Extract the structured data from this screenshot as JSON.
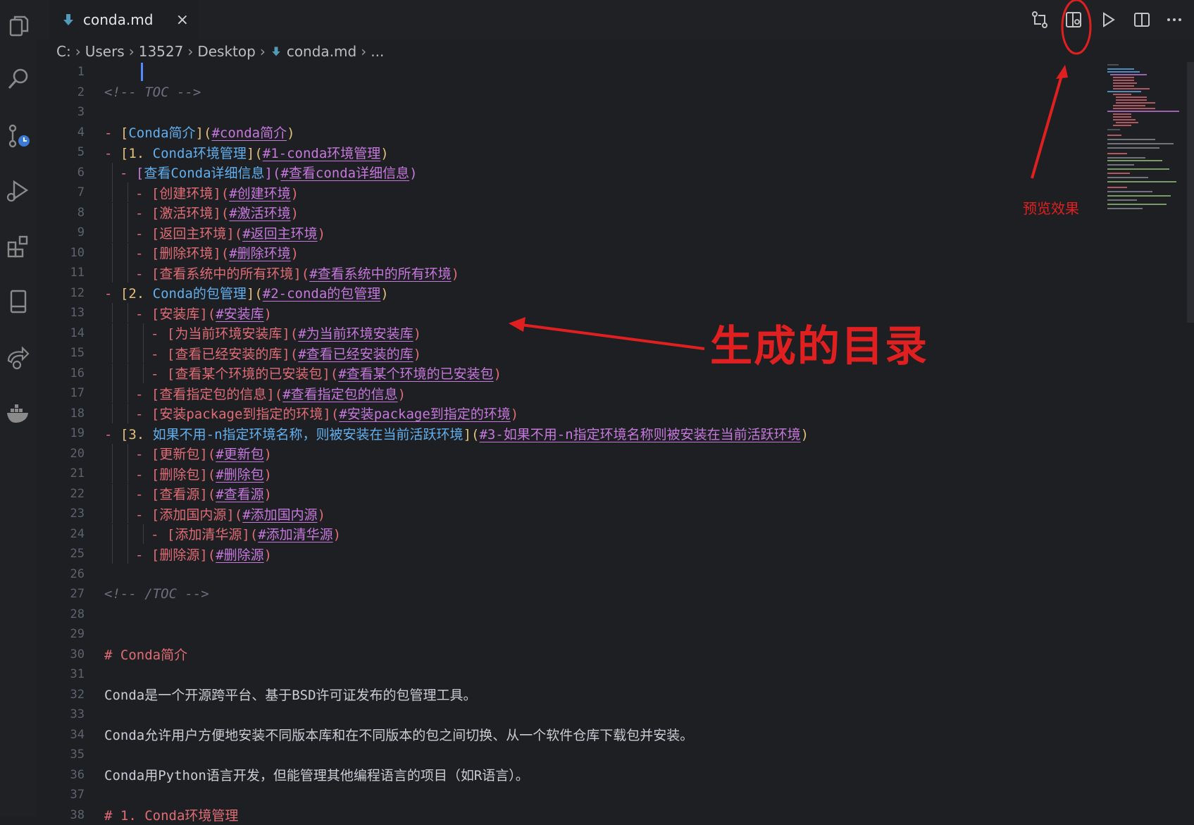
{
  "tab": {
    "label": "conda.md",
    "close": "×"
  },
  "breadcrumb": [
    "C:",
    "Users",
    "13527",
    "Desktop",
    "conda.md",
    "..."
  ],
  "annotations": {
    "preview": "预览效果",
    "toc": "生成的目录"
  },
  "colors": {
    "annotation": "#e02020",
    "link": "#c678dd",
    "heading": "#e06c75"
  },
  "lines": [
    {
      "n": "1",
      "g": 0,
      "s": []
    },
    {
      "n": "2",
      "g": 0,
      "s": [
        {
          "c": "c-comment",
          "t": "<!-- TOC -->"
        }
      ]
    },
    {
      "n": "3",
      "g": 0,
      "s": []
    },
    {
      "n": "4",
      "g": 0,
      "s": [
        {
          "c": "c-dash",
          "t": "- "
        },
        {
          "c": "c-b1",
          "t": "["
        },
        {
          "c": "c-t1",
          "t": "Conda简介"
        },
        {
          "c": "c-b1",
          "t": "]("
        },
        {
          "c": "c-link",
          "t": "#conda简介"
        },
        {
          "c": "c-b1",
          "t": ")"
        }
      ]
    },
    {
      "n": "5",
      "g": 0,
      "s": [
        {
          "c": "c-dash",
          "t": "- "
        },
        {
          "c": "c-b1",
          "t": "["
        },
        {
          "c": "c-num",
          "t": "1. "
        },
        {
          "c": "c-t1",
          "t": "Conda环境管理"
        },
        {
          "c": "c-b1",
          "t": "]("
        },
        {
          "c": "c-link",
          "t": "#1-conda环境管理"
        },
        {
          "c": "c-b1",
          "t": ")"
        }
      ]
    },
    {
      "n": "6",
      "g": 1,
      "s": [
        {
          "c": "c-dash",
          "t": "- "
        },
        {
          "c": "c-b2",
          "t": "["
        },
        {
          "c": "c-t1",
          "t": "查看Conda详细信息"
        },
        {
          "c": "c-b2",
          "t": "]("
        },
        {
          "c": "c-link",
          "t": "#查看conda详细信息"
        },
        {
          "c": "c-b2",
          "t": ")"
        }
      ]
    },
    {
      "n": "7",
      "g": 2,
      "s": [
        {
          "c": "c-dash",
          "t": "- "
        },
        {
          "c": "c-t2",
          "t": "[创建环境]("
        },
        {
          "c": "c-link",
          "t": "#创建环境"
        },
        {
          "c": "c-t2",
          "t": ")"
        }
      ]
    },
    {
      "n": "8",
      "g": 2,
      "s": [
        {
          "c": "c-dash",
          "t": "- "
        },
        {
          "c": "c-t2",
          "t": "[激活环境]("
        },
        {
          "c": "c-link",
          "t": "#激活环境"
        },
        {
          "c": "c-t2",
          "t": ")"
        }
      ]
    },
    {
      "n": "9",
      "g": 2,
      "s": [
        {
          "c": "c-dash",
          "t": "- "
        },
        {
          "c": "c-t2",
          "t": "[返回主环境]("
        },
        {
          "c": "c-link",
          "t": "#返回主环境"
        },
        {
          "c": "c-t2",
          "t": ")"
        }
      ]
    },
    {
      "n": "10",
      "g": 2,
      "s": [
        {
          "c": "c-dash",
          "t": "- "
        },
        {
          "c": "c-t2",
          "t": "[删除环境]("
        },
        {
          "c": "c-link",
          "t": "#删除环境"
        },
        {
          "c": "c-t2",
          "t": ")"
        }
      ]
    },
    {
      "n": "11",
      "g": 2,
      "s": [
        {
          "c": "c-dash",
          "t": "- "
        },
        {
          "c": "c-t2",
          "t": "[查看系统中的所有环境]("
        },
        {
          "c": "c-link",
          "t": "#查看系统中的所有环境"
        },
        {
          "c": "c-t2",
          "t": ")"
        }
      ]
    },
    {
      "n": "12",
      "g": 0,
      "s": [
        {
          "c": "c-dash",
          "t": "- "
        },
        {
          "c": "c-b1",
          "t": "["
        },
        {
          "c": "c-num",
          "t": "2. "
        },
        {
          "c": "c-t1",
          "t": "Conda的包管理"
        },
        {
          "c": "c-b1",
          "t": "]("
        },
        {
          "c": "c-link",
          "t": "#2-conda的包管理"
        },
        {
          "c": "c-b1",
          "t": ")"
        }
      ]
    },
    {
      "n": "13",
      "g": 2,
      "s": [
        {
          "c": "c-dash",
          "t": "- "
        },
        {
          "c": "c-t2",
          "t": "[安装库]("
        },
        {
          "c": "c-link",
          "t": "#安装库"
        },
        {
          "c": "c-t2",
          "t": ")"
        }
      ]
    },
    {
      "n": "14",
      "g": 3,
      "s": [
        {
          "c": "c-dash",
          "t": "- "
        },
        {
          "c": "c-t2",
          "t": "[为当前环境安装库]("
        },
        {
          "c": "c-link",
          "t": "#为当前环境安装库"
        },
        {
          "c": "c-t2",
          "t": ")"
        }
      ]
    },
    {
      "n": "15",
      "g": 3,
      "s": [
        {
          "c": "c-dash",
          "t": "- "
        },
        {
          "c": "c-t2",
          "t": "[查看已经安装的库]("
        },
        {
          "c": "c-link",
          "t": "#查看已经安装的库"
        },
        {
          "c": "c-t2",
          "t": ")"
        }
      ]
    },
    {
      "n": "16",
      "g": 3,
      "s": [
        {
          "c": "c-dash",
          "t": "- "
        },
        {
          "c": "c-t2",
          "t": "[查看某个环境的已安装包]("
        },
        {
          "c": "c-link",
          "t": "#查看某个环境的已安装包"
        },
        {
          "c": "c-t2",
          "t": ")"
        }
      ]
    },
    {
      "n": "17",
      "g": 2,
      "s": [
        {
          "c": "c-dash",
          "t": "- "
        },
        {
          "c": "c-t2",
          "t": "[查看指定包的信息]("
        },
        {
          "c": "c-link",
          "t": "#查看指定包的信息"
        },
        {
          "c": "c-t2",
          "t": ")"
        }
      ]
    },
    {
      "n": "18",
      "g": 2,
      "s": [
        {
          "c": "c-dash",
          "t": "- "
        },
        {
          "c": "c-t2",
          "t": "[安装package到指定的环境]("
        },
        {
          "c": "c-link",
          "t": "#安装package到指定的环境"
        },
        {
          "c": "c-t2",
          "t": ")"
        }
      ]
    },
    {
      "n": "19",
      "g": 0,
      "s": [
        {
          "c": "c-dash",
          "t": "- "
        },
        {
          "c": "c-b1",
          "t": "["
        },
        {
          "c": "c-num",
          "t": "3. "
        },
        {
          "c": "c-t1",
          "t": "如果不用-n指定环境名称，则被安装在当前活跃环境"
        },
        {
          "c": "c-b1",
          "t": "]("
        },
        {
          "c": "c-link",
          "t": "#3-如果不用-n指定环境名称则被安装在当前活跃环境"
        },
        {
          "c": "c-b1",
          "t": ")"
        }
      ]
    },
    {
      "n": "20",
      "g": 2,
      "s": [
        {
          "c": "c-dash",
          "t": "- "
        },
        {
          "c": "c-t2",
          "t": "[更新包]("
        },
        {
          "c": "c-link",
          "t": "#更新包"
        },
        {
          "c": "c-t2",
          "t": ")"
        }
      ]
    },
    {
      "n": "21",
      "g": 2,
      "s": [
        {
          "c": "c-dash",
          "t": "- "
        },
        {
          "c": "c-t2",
          "t": "[删除包]("
        },
        {
          "c": "c-link",
          "t": "#删除包"
        },
        {
          "c": "c-t2",
          "t": ")"
        }
      ]
    },
    {
      "n": "22",
      "g": 2,
      "s": [
        {
          "c": "c-dash",
          "t": "- "
        },
        {
          "c": "c-t2",
          "t": "[查看源]("
        },
        {
          "c": "c-link",
          "t": "#查看源"
        },
        {
          "c": "c-t2",
          "t": ")"
        }
      ]
    },
    {
      "n": "23",
      "g": 2,
      "s": [
        {
          "c": "c-dash",
          "t": "- "
        },
        {
          "c": "c-t2",
          "t": "[添加国内源]("
        },
        {
          "c": "c-link",
          "t": "#添加国内源"
        },
        {
          "c": "c-t2",
          "t": ")"
        }
      ]
    },
    {
      "n": "24",
      "g": 3,
      "s": [
        {
          "c": "c-dash",
          "t": "- "
        },
        {
          "c": "c-t2",
          "t": "[添加清华源]("
        },
        {
          "c": "c-link",
          "t": "#添加清华源"
        },
        {
          "c": "c-t2",
          "t": ")"
        }
      ]
    },
    {
      "n": "25",
      "g": 2,
      "s": [
        {
          "c": "c-dash",
          "t": "- "
        },
        {
          "c": "c-t2",
          "t": "[删除源]("
        },
        {
          "c": "c-link",
          "t": "#删除源"
        },
        {
          "c": "c-t2",
          "t": ")"
        }
      ]
    },
    {
      "n": "26",
      "g": 0,
      "s": []
    },
    {
      "n": "27",
      "g": 0,
      "s": [
        {
          "c": "c-comment",
          "t": "<!-- /TOC -->"
        }
      ]
    },
    {
      "n": "28",
      "g": 0,
      "s": []
    },
    {
      "n": "29",
      "g": 0,
      "s": []
    },
    {
      "n": "30",
      "g": 0,
      "s": [
        {
          "c": "c-head",
          "t": "# Conda简介"
        }
      ]
    },
    {
      "n": "31",
      "g": 0,
      "s": []
    },
    {
      "n": "32",
      "g": 0,
      "s": [
        {
          "c": "c-text",
          "t": "Conda是一个开源跨平台、基于BSD许可证发布的包管理工具。"
        }
      ]
    },
    {
      "n": "33",
      "g": 0,
      "s": []
    },
    {
      "n": "34",
      "g": 0,
      "s": [
        {
          "c": "c-text",
          "t": "Conda允许用户方便地安装不同版本库和在不同版本的包之间切换、从一个软件仓库下载包并安装。"
        }
      ]
    },
    {
      "n": "35",
      "g": 0,
      "s": []
    },
    {
      "n": "36",
      "g": 0,
      "s": [
        {
          "c": "c-text",
          "t": "Conda用Python语言开发，但能管理其他编程语言的项目（如R语言）。"
        }
      ]
    },
    {
      "n": "37",
      "g": 0,
      "s": []
    },
    {
      "n": "38",
      "g": 0,
      "s": [
        {
          "c": "c-head",
          "t": "# 1. Conda环境管理"
        }
      ]
    }
  ]
}
